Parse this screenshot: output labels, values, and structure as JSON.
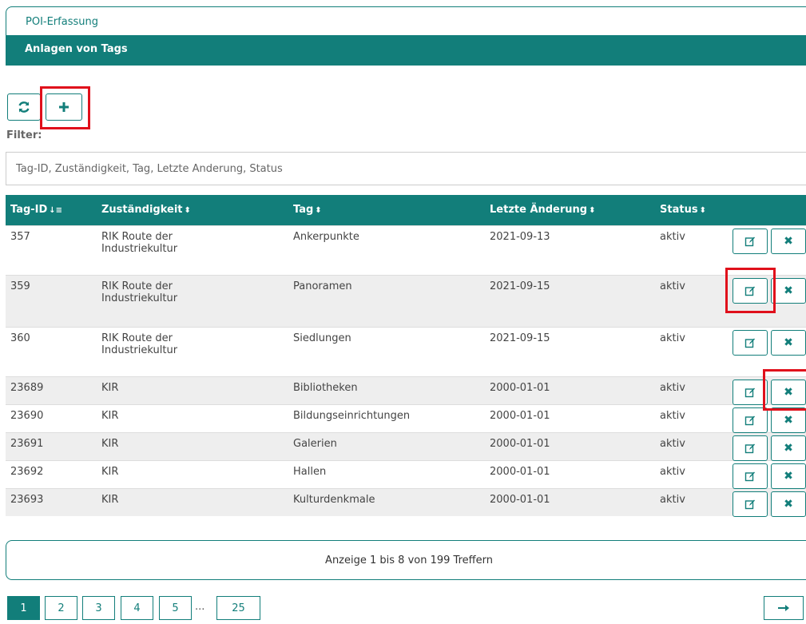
{
  "breadcrumb": {
    "title": "POI-Erfassung"
  },
  "panel": {
    "title": "Anlagen von Tags"
  },
  "toolbar": {
    "refresh_icon": "refresh-icon",
    "add_icon": "plus-icon"
  },
  "filter": {
    "label": "Filter:",
    "placeholder": "Tag-ID, Zuständigkeit, Tag, Letzte Änderung, Status",
    "value": ""
  },
  "table": {
    "columns": [
      "Tag-ID",
      "Zuständigkeit",
      "Tag",
      "Letzte Änderung",
      "Status"
    ],
    "rows": [
      {
        "id": "357",
        "owner": "RIK Route der Industriekultur",
        "tag": "Ankerpunkte",
        "changed": "2021-09-13",
        "status": "aktiv"
      },
      {
        "id": "359",
        "owner": "RIK Route der Industriekultur",
        "tag": "Panoramen",
        "changed": "2021-09-15",
        "status": "aktiv"
      },
      {
        "id": "360",
        "owner": "RIK Route der Industriekultur",
        "tag": "Siedlungen",
        "changed": "2021-09-15",
        "status": "aktiv"
      },
      {
        "id": "23689",
        "owner": "KIR",
        "tag": "Bibliotheken",
        "changed": "2000-01-01",
        "status": "aktiv"
      },
      {
        "id": "23690",
        "owner": "KIR",
        "tag": "Bildungseinrichtungen",
        "changed": "2000-01-01",
        "status": "aktiv"
      },
      {
        "id": "23691",
        "owner": "KIR",
        "tag": "Galerien",
        "changed": "2000-01-01",
        "status": "aktiv"
      },
      {
        "id": "23692",
        "owner": "KIR",
        "tag": "Hallen",
        "changed": "2000-01-01",
        "status": "aktiv"
      },
      {
        "id": "23693",
        "owner": "KIR",
        "tag": "Kulturdenkmale",
        "changed": "2000-01-01",
        "status": "aktiv"
      }
    ]
  },
  "info": {
    "text": "Anzeige 1 bis 8 von 199 Treffern"
  },
  "pagination": {
    "pages": [
      "1",
      "2",
      "3",
      "4",
      "5",
      "25"
    ],
    "active": "1",
    "ellipsis": "...",
    "next_icon": "arrow-right-icon"
  },
  "colors": {
    "accent": "#127e7a",
    "highlight": "#e0101b",
    "row_alt": "#eeeeee"
  }
}
